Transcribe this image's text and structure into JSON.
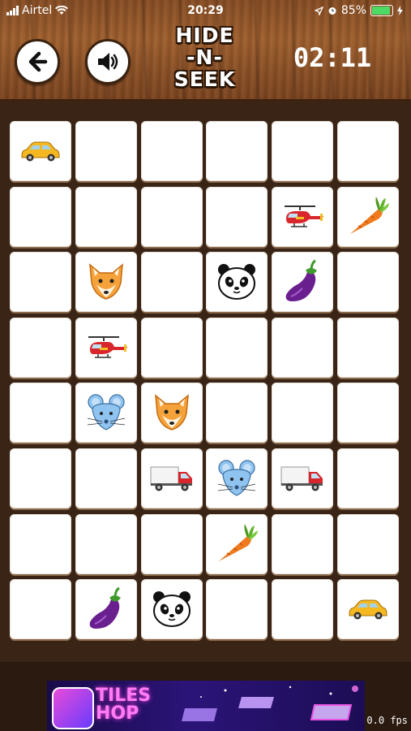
{
  "status_bar": {
    "carrier": "Airtel",
    "time": "20:29",
    "battery_percent": "85%",
    "battery_level": 0.85
  },
  "header": {
    "logo_line1": "HIDE",
    "logo_line2": "-N-",
    "logo_line3": "SEEK",
    "timer": "02:11",
    "back_icon": "arrow-left-icon",
    "sound_icon": "speaker-icon"
  },
  "board": {
    "rows": [
      [
        "car",
        "",
        "",
        "",
        "",
        ""
      ],
      [
        "",
        "",
        "",
        "",
        "helicopter",
        "carrot"
      ],
      [
        "",
        "fox",
        "",
        "panda",
        "eggplant",
        ""
      ],
      [
        "",
        "helicopter",
        "",
        "",
        "",
        ""
      ],
      [
        "",
        "mouse",
        "fox",
        "",
        "",
        ""
      ],
      [
        "",
        "",
        "truck",
        "mouse",
        "truck",
        ""
      ],
      [
        "",
        "",
        "",
        "carrot",
        "",
        ""
      ],
      [
        "",
        "eggplant",
        "panda",
        "",
        "",
        "car"
      ]
    ]
  },
  "ad": {
    "title_line1": "TILES",
    "title_line2": "HOP"
  },
  "debug": {
    "fps": "0.0 fps"
  }
}
